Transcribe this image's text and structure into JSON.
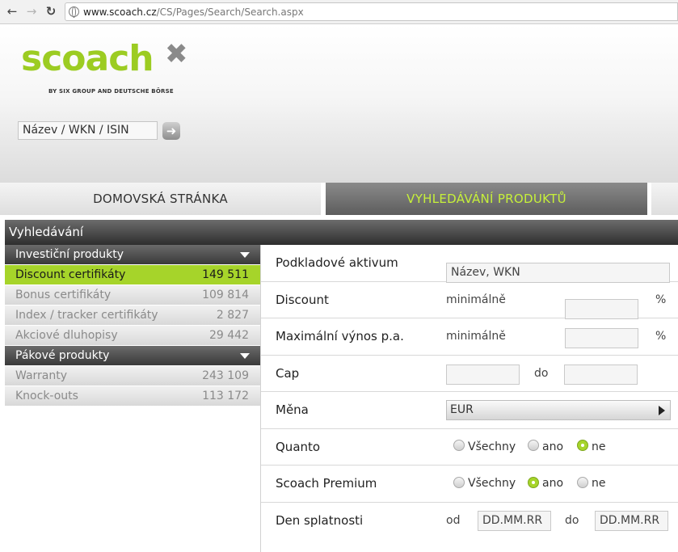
{
  "browser": {
    "url_host": "www.scoach.cz",
    "url_path": "/CS/Pages/Search/Search.aspx"
  },
  "header": {
    "logo_text": "scoach",
    "logo_sub": "BY SIX GROUP AND DEUTSCHE BÖRSE",
    "search_placeholder": "Název / WKN / ISIN",
    "brand_color": "#9ccc22"
  },
  "nav": {
    "home": "DOMOVSKÁ STRÁNKA",
    "search": "VYHLEDÁVÁNÍ PRODUKTŮ"
  },
  "panel_title": "Vyhledávání",
  "sidebar": {
    "cat1": "Investiční produkty",
    "items1": [
      {
        "label": "Discount certifikáty",
        "count": "149 511"
      },
      {
        "label": "Bonus certifikáty",
        "count": "109 814"
      },
      {
        "label": "Index / tracker certifikáty",
        "count": "2 827"
      },
      {
        "label": "Akciové dluhopisy",
        "count": "29 442"
      }
    ],
    "cat2": "Pákové produkty",
    "items2": [
      {
        "label": "Warranty",
        "count": "243 109"
      },
      {
        "label": "Knock-outs",
        "count": "113 172"
      }
    ]
  },
  "form": {
    "underlying_label": "Podkladové aktivum",
    "underlying_placeholder": "Název, WKN",
    "discount_label": "Discount",
    "discount_min": "minimálně",
    "discount_unit": "%",
    "yield_label": "Maximální výnos p.a.",
    "yield_min": "minimálně",
    "yield_unit": "%",
    "cap_label": "Cap",
    "cap_to": "do",
    "currency_label": "Měna",
    "currency_value": "EUR",
    "quanto_label": "Quanto",
    "premium_label": "Scoach Premium",
    "radio_all": "Všechny",
    "radio_yes": "ano",
    "radio_no": "ne",
    "quanto_selected": "ne",
    "premium_selected": "ano",
    "maturity_label": "Den splatnosti",
    "maturity_from": "od",
    "maturity_to": "do",
    "date_placeholder": "DD.MM.RR"
  }
}
